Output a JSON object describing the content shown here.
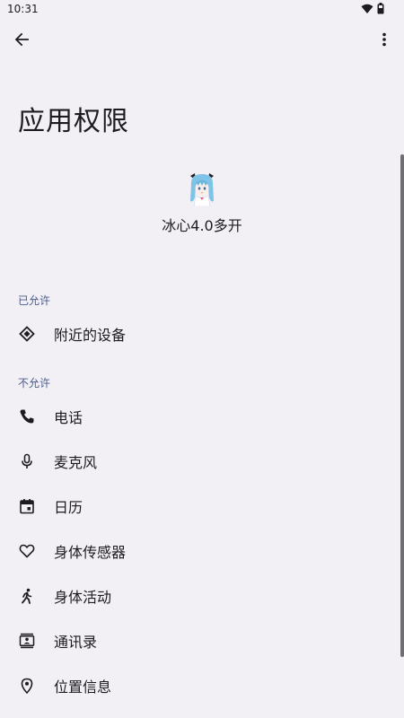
{
  "status_bar": {
    "time": "10:31",
    "icons": [
      "wifi-icon",
      "battery-icon"
    ]
  },
  "top_bar": {
    "back_icon": "arrow-back-icon",
    "more_icon": "more-vert-icon"
  },
  "page": {
    "title": "应用权限"
  },
  "app": {
    "name": "冰心4.0多开",
    "icon": "app-avatar-icon"
  },
  "sections": {
    "allowed": {
      "header": "已允许",
      "items": [
        {
          "label": "附近的设备",
          "icon": "nearby-devices-icon"
        }
      ]
    },
    "denied": {
      "header": "不允许",
      "items": [
        {
          "label": "电话",
          "icon": "phone-icon"
        },
        {
          "label": "麦克风",
          "icon": "microphone-icon"
        },
        {
          "label": "日历",
          "icon": "calendar-icon"
        },
        {
          "label": "身体传感器",
          "icon": "heart-icon"
        },
        {
          "label": "身体活动",
          "icon": "walking-icon"
        },
        {
          "label": "通讯录",
          "icon": "contacts-icon"
        },
        {
          "label": "位置信息",
          "icon": "location-icon"
        }
      ]
    }
  },
  "colors": {
    "background": "#f2f0f5",
    "section_header": "#4a5b8c",
    "text": "#1c1b1f"
  }
}
